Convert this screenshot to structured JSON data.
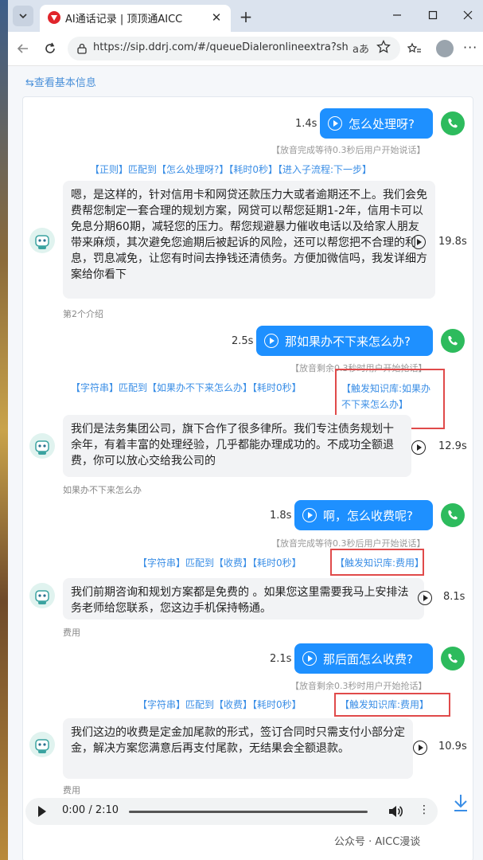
{
  "browser": {
    "tab_title": "AI通话记录 | 顶顶通AICC",
    "url": "https://sip.ddrj.com/#/queueDialeronlineextra?sha...",
    "reader_label": "aあ"
  },
  "page": {
    "back_link": "⇆查看基本信息"
  },
  "conversation": [
    {
      "kind": "user",
      "text": "怎么处理呀?",
      "duration": "1.4s",
      "hint": "【放音完成等待0.3秒后用户开始说话】"
    },
    {
      "kind": "match",
      "text": "【正则】匹配到【怎么处理呀?】【耗时0秒】【进入子流程:下一步】"
    },
    {
      "kind": "bot",
      "text": "嗯，是这样的，针对信用卡和网贷还款压力大或者逾期还不上。我们会免费帮您制定一套合理的规划方案，网贷可以帮您延期1-2年，信用卡可以免息分期60期，减轻您的压力。帮您规避暴力催收电话以及给家人朋友带来麻烦，其次避免您逾期后被起诉的风险，还可以帮您把不合理的利息，罚息减免，让您有时间去挣钱还清债务。方便加微信吗，我发详细方案给你看下",
      "duration": "19.8s",
      "note": "第2个介绍"
    },
    {
      "kind": "user",
      "text": "那如果办不下来怎么办?",
      "duration": "2.5s",
      "hint": "【放音剩余0.3秒时用户开始抢话】"
    },
    {
      "kind": "match",
      "text": "【字符串】匹配到【如果办不下来怎么办】【耗时0秒】",
      "trigger": "【触发知识库:如果办不下来怎么办】"
    },
    {
      "kind": "bot",
      "text": "我们是法务集团公司，旗下合作了很多律所。我们专注债务规划十余年，有着丰富的处理经验，几乎都能办理成功的。不成功全额退费，你可以放心交给我公司的",
      "duration": "12.9s",
      "note": "如果办不下来怎么办"
    },
    {
      "kind": "user",
      "text": "啊，怎么收费呢?",
      "duration": "1.8s",
      "hint": "【放音完成等待0.3秒后用户开始说话】"
    },
    {
      "kind": "match",
      "text": "【字符串】匹配到【收费】【耗时0秒】",
      "trigger": "【触发知识库:费用】"
    },
    {
      "kind": "bot",
      "text": "我们前期咨询和规划方案都是免费的 。如果您这里需要我马上安排法务老师给您联系，您这边手机保持畅通。",
      "duration": "8.1s",
      "note": "费用"
    },
    {
      "kind": "user",
      "text": "那后面怎么收费?",
      "duration": "2.1s",
      "hint": "【放音剩余0.3秒时用户开始抢话】"
    },
    {
      "kind": "match",
      "text": "【字符串】匹配到【收费】【耗时0秒】",
      "trigger": "【触发知识库:费用】"
    },
    {
      "kind": "bot",
      "text": "我们这边的收费是定金加尾款的形式，签订合同时只需支付小部分定金，解决方案您满意后再支付尾款，无结果会全额退款。",
      "duration": "10.9s",
      "note": "费用"
    }
  ],
  "audio": {
    "time": "0:00 / 2:10"
  },
  "watermark": "公众号 · AICC漫谈",
  "colors": {
    "accent": "#1e90ff",
    "phone": "#2dbb5d",
    "highlight": "#e04a4a"
  }
}
